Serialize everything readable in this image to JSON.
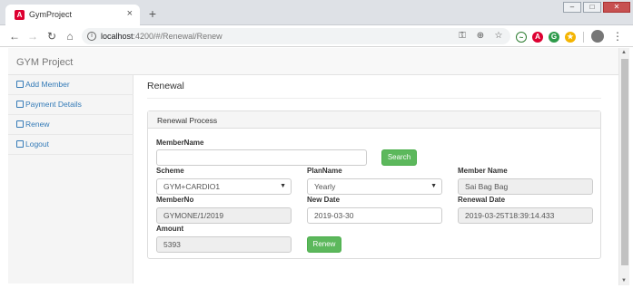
{
  "browser": {
    "tab_title": "GymProject",
    "tab_close": "×",
    "new_tab": "+",
    "url_host": "localhost",
    "url_rest": ":4200/#/Renewal/Renew",
    "window_controls": {
      "minimize": "–",
      "maximize": "□",
      "close": "✕"
    },
    "icons": [
      "back-icon",
      "forward-icon",
      "reload-icon",
      "home-icon",
      "info-icon",
      "key-icon",
      "zoom-icon",
      "bookmark-star-icon",
      "extension-icons",
      "profile-avatar",
      "menu-kebab-icon"
    ]
  },
  "app": {
    "brand": "GYM Project"
  },
  "sidebar": {
    "items": [
      {
        "label": "Add Member"
      },
      {
        "label": "Payment Details"
      },
      {
        "label": "Renew"
      },
      {
        "label": "Logout"
      }
    ]
  },
  "page": {
    "title": "Renewal",
    "panel_title": "Renewal Process"
  },
  "form": {
    "member_name_label": "MemberName",
    "member_name_value": "",
    "search_button": "Search",
    "scheme_label": "Scheme",
    "scheme_value": "GYM+CARDIO1",
    "plan_label": "PlanName",
    "plan_value": "Yearly",
    "member_display_label": "Member Name",
    "member_display_value": "Sai Bag Bag",
    "member_no_label": "MemberNo",
    "member_no_value": "GYMONE/1/2019",
    "new_date_label": "New Date",
    "new_date_value": "2019-03-30",
    "renewal_date_label": "Renewal Date",
    "renewal_date_value": "2019-03-25T18:39:14.433",
    "amount_label": "Amount",
    "amount_value": "5393",
    "renew_button": "Renew"
  },
  "colors": {
    "link": "#337ab7",
    "success": "#5cb85c",
    "angular_red": "#dd0031"
  }
}
